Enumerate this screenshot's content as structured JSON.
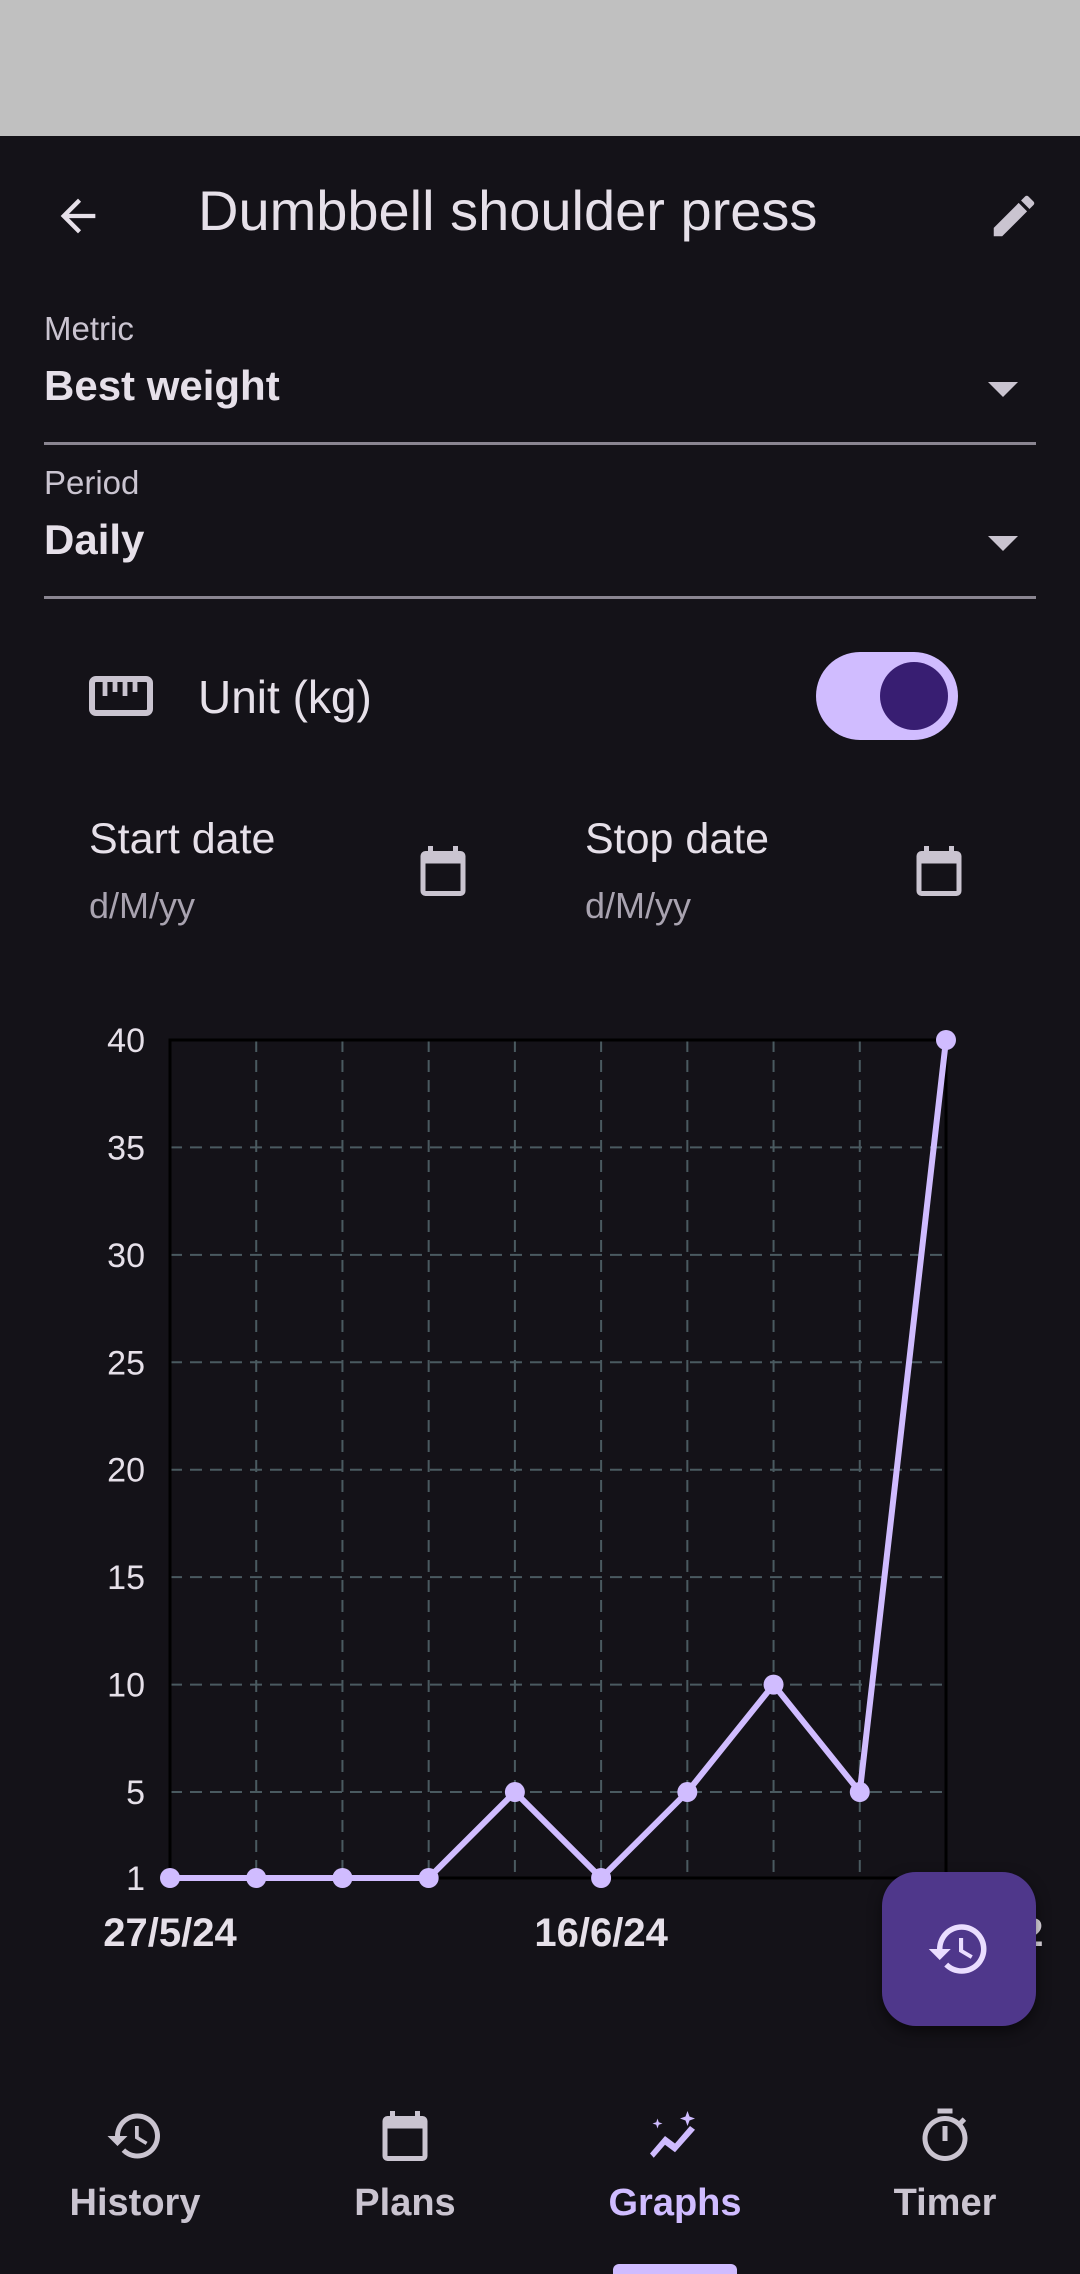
{
  "appbar": {
    "title": "Dumbbell shoulder press",
    "back_icon": "arrow-back-icon",
    "edit_icon": "pencil-icon"
  },
  "metric": {
    "label": "Metric",
    "value": "Best weight"
  },
  "period": {
    "label": "Period",
    "value": "Daily"
  },
  "unit": {
    "icon": "ruler-icon",
    "label": "Unit (kg)",
    "toggle_on": true
  },
  "start_date": {
    "label": "Start date",
    "hint": "d/M/yy",
    "icon": "calendar-icon"
  },
  "stop_date": {
    "label": "Stop date",
    "hint": "d/M/yy",
    "icon": "calendar-icon"
  },
  "fab": {
    "icon": "history-restore-icon"
  },
  "nav": {
    "items": [
      {
        "label": "History",
        "icon": "history-icon",
        "active": false
      },
      {
        "label": "Plans",
        "icon": "calendar-icon",
        "active": false
      },
      {
        "label": "Graphs",
        "icon": "graph-icon",
        "active": true
      },
      {
        "label": "Timer",
        "icon": "stopwatch-icon",
        "active": false
      }
    ]
  },
  "colors": {
    "background": "#141218",
    "accent": "#d0bcff",
    "fab": "#4f378b",
    "grid": "#4a5a60"
  },
  "chart_data": {
    "type": "line",
    "x_tick_labels": [
      "27/5/24",
      "16/6/24",
      "2"
    ],
    "x_tick_indices": [
      0,
      5,
      10
    ],
    "points": [
      1,
      1,
      1,
      1,
      5,
      1,
      5,
      10,
      5,
      40
    ],
    "y_ticks": [
      1,
      5,
      10,
      15,
      20,
      25,
      30,
      35,
      40
    ],
    "ylim": [
      1,
      40
    ],
    "grid": true,
    "series_color": "#d0bcff"
  }
}
